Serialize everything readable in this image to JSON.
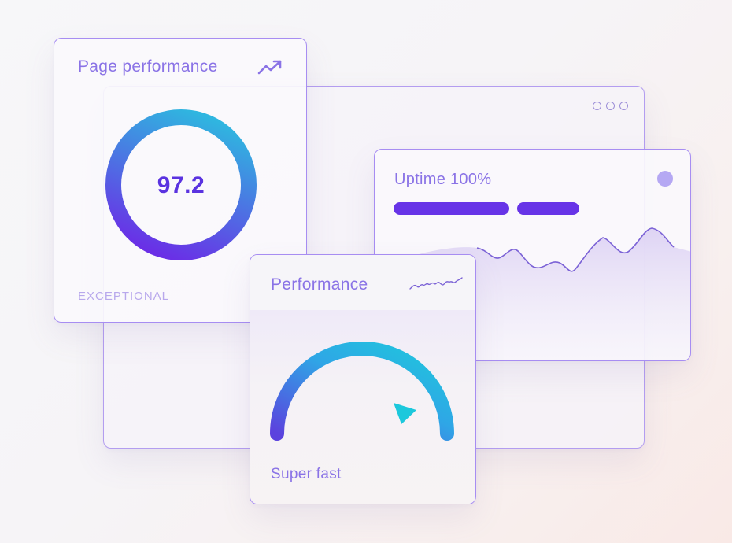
{
  "page_performance": {
    "title": "Page performance",
    "score": "97.2",
    "rating": "EXCEPTIONAL",
    "icon": "trending-up-icon",
    "ring_progress": 1.0
  },
  "browser_window": {
    "control_icons": [
      "circle-icon",
      "circle-icon",
      "circle-icon"
    ]
  },
  "uptime": {
    "title": "Uptime 100%",
    "status_dot_color": "#b5a8f3",
    "bar_color": "#6734e7"
  },
  "speed": {
    "title": "Performance",
    "label": "Super fast",
    "icon": "squiggle-line-icon",
    "gauge_level": 0.85
  },
  "colors": {
    "accent": "#8a73e6",
    "score": "#5a33e0",
    "gradient_start": "#22c1dc",
    "gradient_end": "#6a2fe6"
  }
}
